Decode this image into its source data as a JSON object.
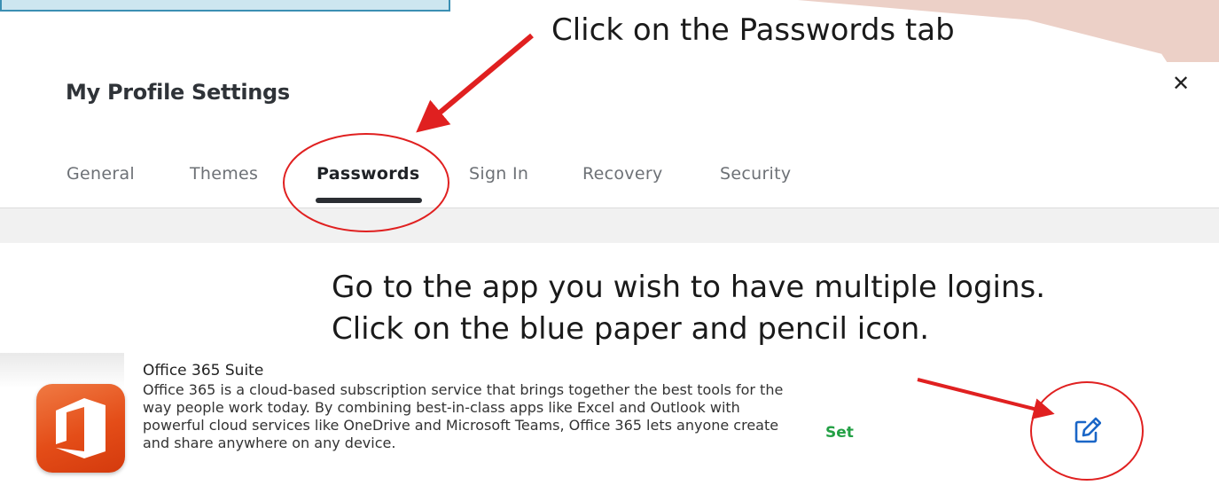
{
  "instructions": {
    "step1": "Click on the Passwords tab",
    "step2_line1": "Go to the app you wish to have multiple logins.",
    "step2_line2": "Click on the blue paper and pencil icon."
  },
  "profile": {
    "title": "My Profile Settings",
    "close_symbol": "✕",
    "tabs": [
      {
        "label": "General",
        "active": false
      },
      {
        "label": "Themes",
        "active": false
      },
      {
        "label": "Passwords",
        "active": true
      },
      {
        "label": "Sign In",
        "active": false
      },
      {
        "label": "Recovery",
        "active": false
      },
      {
        "label": "Security",
        "active": false
      }
    ]
  },
  "app": {
    "name": "Office 365 Suite",
    "description": "Office 365 is a cloud-based subscription service that brings together the best tools for the way people work today. By combining best-in-class apps like Excel and Outlook with powerful cloud services like OneDrive and Microsoft Teams, Office 365 lets anyone create and share anywhere on any device.",
    "status": "Set",
    "icon": "office-logo",
    "edit_icon": "edit-icon"
  },
  "colors": {
    "annotation_red": "#e02020",
    "status_green": "#23a045",
    "edit_blue": "#1a66c7",
    "office_orange": "#e44d18"
  }
}
